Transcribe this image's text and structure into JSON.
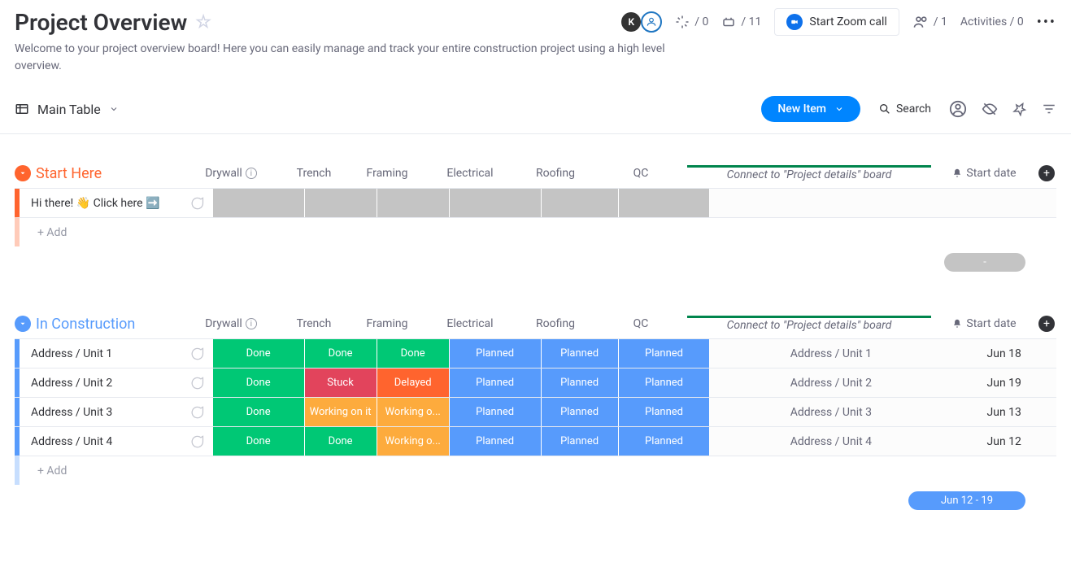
{
  "header": {
    "title": "Project Overview",
    "description": "Welcome to your project overview board! Here you can easily manage and track your entire construction project using a high level overview.",
    "stat1": "/ 0",
    "stat2": "/ 11",
    "zoom_label": "Start Zoom call",
    "people": "/ 1",
    "activities": "Activities / 0",
    "avatar_letter": "K"
  },
  "toolbar": {
    "view": "Main Table",
    "new_item": "New Item",
    "search": "Search"
  },
  "columns": {
    "drywall": "Drywall",
    "trench": "Trench",
    "framing": "Framing",
    "electrical": "Electrical",
    "roofing": "Roofing",
    "qc": "QC",
    "connect": "Connect to \"Project details\" board",
    "start_date": "Start date"
  },
  "status_colors": {
    "Done": "#00c875",
    "Planned": "#579bfc",
    "Stuck": "#e2445c",
    "Delayed": "#ff642e",
    "Working on it": "#fdab3d",
    "Working o...": "#fdab3d"
  },
  "groups": [
    {
      "name": "Start Here",
      "color": "#ff642e",
      "rows": [
        {
          "name": "Hi there! 👋 Click here ➡️",
          "cells": [
            "",
            "",
            "",
            "",
            "",
            ""
          ],
          "connect": "",
          "date": ""
        }
      ],
      "add_label": "+ Add",
      "summary": "-",
      "summary_style": "gray"
    },
    {
      "name": "In Construction",
      "color": "#579bfc",
      "rows": [
        {
          "name": "Address / Unit 1",
          "cells": [
            "Done",
            "Done",
            "Done",
            "Planned",
            "Planned",
            "Planned"
          ],
          "connect": "Address / Unit 1",
          "date": "Jun 18"
        },
        {
          "name": "Address / Unit 2",
          "cells": [
            "Done",
            "Stuck",
            "Delayed",
            "Planned",
            "Planned",
            "Planned"
          ],
          "connect": "Address / Unit 2",
          "date": "Jun 19"
        },
        {
          "name": "Address / Unit 3",
          "cells": [
            "Done",
            "Working on it",
            "Working o...",
            "Planned",
            "Planned",
            "Planned"
          ],
          "connect": "Address / Unit 3",
          "date": "Jun 13"
        },
        {
          "name": "Address / Unit 4",
          "cells": [
            "Done",
            "Done",
            "Working o...",
            "Planned",
            "Planned",
            "Planned"
          ],
          "connect": "Address / Unit 4",
          "date": "Jun 12"
        }
      ],
      "add_label": "+ Add",
      "summary": "Jun 12 - 19",
      "summary_style": "blue"
    }
  ],
  "col_widths": [
    "114",
    "90",
    "90",
    "114",
    "96",
    "114"
  ]
}
